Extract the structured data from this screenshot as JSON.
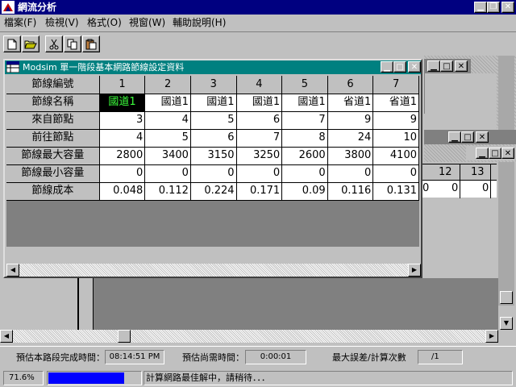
{
  "app": {
    "title": "網流分析"
  },
  "menu": [
    "檔案(F)",
    "檢視(V)",
    "格式(O)",
    "視窗(W)",
    "輔助說明(H)"
  ],
  "toolbar": {
    "buttons": [
      "new-file-icon",
      "open-folder-icon",
      "cut-icon",
      "copy-icon",
      "paste-icon"
    ]
  },
  "window": {
    "title": "Modsim 單一階段基本網路節線設定資料",
    "row_headers": [
      "節線編號",
      "節線名稱",
      "來自節點",
      "前往節點",
      "節線最大容量",
      "節線最小容量",
      "節線成本"
    ],
    "columns": [
      {
        "id": "1",
        "name": "國道1",
        "from": "3",
        "to": "4",
        "max": "2800",
        "min": "0",
        "cost": "0.048"
      },
      {
        "id": "2",
        "name": "國道1",
        "from": "4",
        "to": "5",
        "max": "3400",
        "min": "0",
        "cost": "0.112"
      },
      {
        "id": "3",
        "name": "國道1",
        "from": "5",
        "to": "6",
        "max": "3150",
        "min": "0",
        "cost": "0.224"
      },
      {
        "id": "4",
        "name": "國道1",
        "from": "6",
        "to": "7",
        "max": "3250",
        "min": "0",
        "cost": "0.171"
      },
      {
        "id": "5",
        "name": "國道1",
        "from": "7",
        "to": "8",
        "max": "2600",
        "min": "0",
        "cost": "0.09"
      },
      {
        "id": "6",
        "name": "省道1",
        "from": "9",
        "to": "24",
        "max": "3800",
        "min": "0",
        "cost": "0.116"
      },
      {
        "id": "7",
        "name": "省道1",
        "from": "9",
        "to": "10",
        "max": "4100",
        "min": "0",
        "cost": "0.131"
      }
    ]
  },
  "bg_grid": {
    "headers": [
      "12",
      "13"
    ],
    "values": [
      "0",
      "0",
      "0"
    ]
  },
  "status": {
    "est_finish_label": "預估本路段完成時間：",
    "est_finish_value": "08:14:51 PM",
    "est_remaining_label": "預估尚需時間：",
    "est_remaining_value": "0:00:01",
    "max_error_label": "最大誤差/計算次數",
    "max_error_value": "/1",
    "progress_text": "71.6%",
    "progress": 0.716,
    "message": "計算網路最佳解中，請稍待．．．"
  }
}
